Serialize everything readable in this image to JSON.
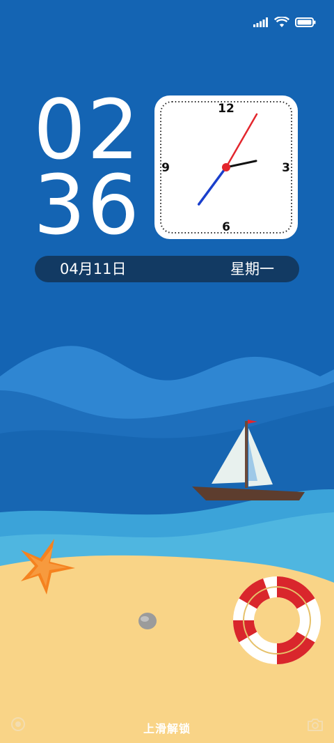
{
  "status_bar": {
    "signal_icon": "cellular-signal-icon",
    "wifi_icon": "wifi-icon",
    "battery_icon": "battery-icon",
    "battery_level": 1.0
  },
  "lock_screen": {
    "time_hours": "02",
    "time_minutes": "36",
    "analog_clock": {
      "numerals": [
        "12",
        "3",
        "6",
        "9"
      ],
      "hour": 2,
      "minute": 36,
      "second": 5
    },
    "date": "04月11日",
    "weekday": "星期一",
    "unlock_hint": "上滑解锁",
    "left_icon": "circle-icon",
    "right_icon": "camera-icon"
  },
  "colors": {
    "sky": "#1464b3",
    "date_bar": "#123a63",
    "second_hand": "#e3262d",
    "minute_hand": "#1a3fcc",
    "sand": "#f9d487",
    "starfish": "#f5821f",
    "lifebuoy_red": "#d9262c"
  }
}
